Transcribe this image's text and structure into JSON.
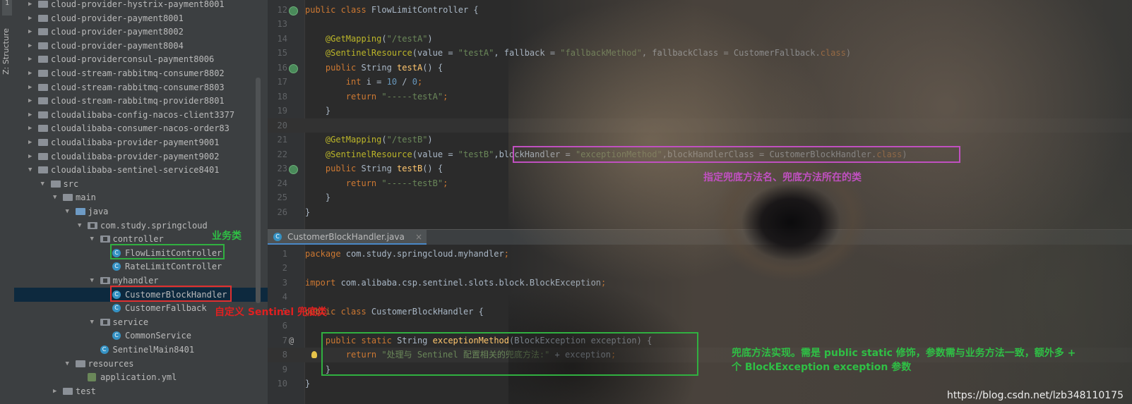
{
  "toolstrip": {
    "project_tab": "1",
    "structure_tab": "Z: Structure"
  },
  "tree": [
    {
      "label": "cloud-provider-hystrix-payment8001",
      "level": 1,
      "type": "module",
      "arrow": "▶"
    },
    {
      "label": "cloud-provider-payment8001",
      "level": 1,
      "type": "module",
      "arrow": "▶"
    },
    {
      "label": "cloud-provider-payment8002",
      "level": 1,
      "type": "module",
      "arrow": "▶"
    },
    {
      "label": "cloud-provider-payment8004",
      "level": 1,
      "type": "module",
      "arrow": "▶"
    },
    {
      "label": "cloud-providerconsul-payment8006",
      "level": 1,
      "type": "module",
      "arrow": "▶"
    },
    {
      "label": "cloud-stream-rabbitmq-consumer8802",
      "level": 1,
      "type": "module",
      "arrow": "▶"
    },
    {
      "label": "cloud-stream-rabbitmq-consumer8803",
      "level": 1,
      "type": "module",
      "arrow": "▶"
    },
    {
      "label": "cloud-stream-rabbitmq-provider8801",
      "level": 1,
      "type": "module",
      "arrow": "▶"
    },
    {
      "label": "cloudalibaba-config-nacos-client3377",
      "level": 1,
      "type": "module",
      "arrow": "▶"
    },
    {
      "label": "cloudalibaba-consumer-nacos-order83",
      "level": 1,
      "type": "module",
      "arrow": "▶"
    },
    {
      "label": "cloudalibaba-provider-payment9001",
      "level": 1,
      "type": "module",
      "arrow": "▶"
    },
    {
      "label": "cloudalibaba-provider-payment9002",
      "level": 1,
      "type": "module",
      "arrow": "▶"
    },
    {
      "label": "cloudalibaba-sentinel-service8401",
      "level": 1,
      "type": "module",
      "arrow": "▼"
    },
    {
      "label": "src",
      "level": 2,
      "type": "folder",
      "arrow": "▼"
    },
    {
      "label": "main",
      "level": 3,
      "type": "folder",
      "arrow": "▼"
    },
    {
      "label": "java",
      "level": 4,
      "type": "folder-blue",
      "arrow": "▼"
    },
    {
      "label": "com.study.springcloud",
      "level": 5,
      "type": "package",
      "arrow": "▼"
    },
    {
      "label": "controller",
      "level": 6,
      "type": "package",
      "arrow": "▼"
    },
    {
      "label": "FlowLimitController",
      "level": 7,
      "type": "class",
      "arrow": ""
    },
    {
      "label": "RateLimitController",
      "level": 7,
      "type": "class",
      "arrow": ""
    },
    {
      "label": "myhandler",
      "level": 6,
      "type": "package",
      "arrow": "▼"
    },
    {
      "label": "CustomerBlockHandler",
      "level": 7,
      "type": "class",
      "arrow": "",
      "selected": true
    },
    {
      "label": "CustomerFallback",
      "level": 7,
      "type": "class",
      "arrow": ""
    },
    {
      "label": "service",
      "level": 6,
      "type": "package",
      "arrow": "▼"
    },
    {
      "label": "CommonService",
      "level": 7,
      "type": "class",
      "arrow": ""
    },
    {
      "label": "SentinelMain8401",
      "level": 6,
      "type": "spring",
      "arrow": ""
    },
    {
      "label": "resources",
      "level": 4,
      "type": "folder",
      "arrow": "▼"
    },
    {
      "label": "application.yml",
      "level": 5,
      "type": "yml",
      "arrow": ""
    },
    {
      "label": "test",
      "level": 3,
      "type": "folder",
      "arrow": "▶"
    }
  ],
  "editor_top": {
    "lines": [
      {
        "n": "12",
        "icon": true,
        "tokens": [
          [
            "kw",
            "public class "
          ],
          [
            "lv",
            "FlowLimitController {"
          ]
        ]
      },
      {
        "n": "13",
        "tokens": []
      },
      {
        "n": "14",
        "tokens": [
          [
            "lv",
            "    "
          ],
          [
            "an",
            "@GetMapping"
          ],
          [
            "lv",
            "("
          ],
          [
            "st",
            "\"/testA\""
          ],
          [
            "lv",
            ")"
          ]
        ]
      },
      {
        "n": "15",
        "tokens": [
          [
            "lv",
            "    "
          ],
          [
            "an",
            "@SentinelResource"
          ],
          [
            "lv",
            "("
          ],
          [
            "lv",
            "value = "
          ],
          [
            "st",
            "\"testA\""
          ],
          [
            "lv",
            ", fallback = "
          ],
          [
            "st",
            "\"fallbackMethod\""
          ],
          [
            "lv",
            ", fallbackClass = CustomerFallback."
          ],
          [
            "kw",
            "class"
          ],
          [
            "lv",
            ")"
          ]
        ]
      },
      {
        "n": "16",
        "icon": true,
        "tokens": [
          [
            "lv",
            "    "
          ],
          [
            "kw",
            "public "
          ],
          [
            "lv",
            "String "
          ],
          [
            "fn",
            "testA"
          ],
          [
            "lv",
            "() {"
          ]
        ]
      },
      {
        "n": "17",
        "tokens": [
          [
            "lv",
            "        "
          ],
          [
            "kw",
            "int "
          ],
          [
            "lv",
            "i = "
          ],
          [
            "nm",
            "10"
          ],
          [
            "lv",
            " / "
          ],
          [
            "nm",
            "0"
          ],
          [
            "kw",
            ";"
          ]
        ]
      },
      {
        "n": "18",
        "tokens": [
          [
            "lv",
            "        "
          ],
          [
            "kw",
            "return "
          ],
          [
            "st",
            "\"-----testA\""
          ],
          [
            "kw",
            ";"
          ]
        ]
      },
      {
        "n": "19",
        "tokens": [
          [
            "lv",
            "    }"
          ]
        ]
      },
      {
        "n": "20",
        "cur": true,
        "tokens": []
      },
      {
        "n": "21",
        "tokens": [
          [
            "lv",
            "    "
          ],
          [
            "an",
            "@GetMapping"
          ],
          [
            "lv",
            "("
          ],
          [
            "st",
            "\"/testB\""
          ],
          [
            "lv",
            ")"
          ]
        ]
      },
      {
        "n": "22",
        "tokens": [
          [
            "lv",
            "    "
          ],
          [
            "an",
            "@SentinelResource"
          ],
          [
            "lv",
            "("
          ],
          [
            "lv",
            "value = "
          ],
          [
            "st",
            "\"testB\""
          ],
          [
            "lv",
            ",blockHandler = "
          ],
          [
            "st",
            "\"exceptionMethod\""
          ],
          [
            "lv",
            ",blockHandlerClass = CustomerBlockHandler."
          ],
          [
            "kw",
            "class"
          ],
          [
            "lv",
            ")"
          ]
        ]
      },
      {
        "n": "23",
        "icon": true,
        "tokens": [
          [
            "lv",
            "    "
          ],
          [
            "kw",
            "public "
          ],
          [
            "lv",
            "String "
          ],
          [
            "fn",
            "testB"
          ],
          [
            "lv",
            "() {"
          ]
        ]
      },
      {
        "n": "24",
        "tokens": [
          [
            "lv",
            "        "
          ],
          [
            "kw",
            "return "
          ],
          [
            "st",
            "\"-----testB\""
          ],
          [
            "kw",
            ";"
          ]
        ]
      },
      {
        "n": "25",
        "tokens": [
          [
            "lv",
            "    }"
          ]
        ]
      },
      {
        "n": "26",
        "tokens": [
          [
            "lv",
            "}"
          ]
        ]
      }
    ]
  },
  "tab": {
    "label": "CustomerBlockHandler.java",
    "close": "×"
  },
  "editor_bottom": {
    "lines": [
      {
        "n": "1",
        "tokens": [
          [
            "kw",
            "package "
          ],
          [
            "lv",
            "com.study.springcloud.myhandler"
          ],
          [
            "kw",
            ";"
          ]
        ]
      },
      {
        "n": "2",
        "tokens": []
      },
      {
        "n": "3",
        "tokens": [
          [
            "kw",
            "import "
          ],
          [
            "lv",
            "com.alibaba.csp.sentinel.slots.block.BlockException"
          ],
          [
            "kw",
            ";"
          ]
        ]
      },
      {
        "n": "4",
        "tokens": []
      },
      {
        "n": "5",
        "tokens": [
          [
            "kw",
            "public class "
          ],
          [
            "lv",
            "CustomerBlockHandler {"
          ]
        ]
      },
      {
        "n": "6",
        "tokens": []
      },
      {
        "n": "7",
        "gmark": "@",
        "tokens": [
          [
            "lv",
            "    "
          ],
          [
            "kw",
            "public static "
          ],
          [
            "lv",
            "String "
          ],
          [
            "fn",
            "exceptionMethod"
          ],
          [
            "lv",
            "(BlockException exception) {"
          ]
        ]
      },
      {
        "n": "8",
        "cur": true,
        "bulb": true,
        "tokens": [
          [
            "lv",
            "        "
          ],
          [
            "kw",
            "return "
          ],
          [
            "st",
            "\"处理与 Sentinel 配置相关的兜底方法:\""
          ],
          [
            "lv",
            " + exception"
          ],
          [
            "kw",
            ";"
          ]
        ]
      },
      {
        "n": "9",
        "tokens": [
          [
            "lv",
            "    }"
          ]
        ]
      },
      {
        "n": "10",
        "tokens": [
          [
            "lv",
            "}"
          ]
        ]
      }
    ]
  },
  "annotations": {
    "magenta_note": "指定兜底方法名、兜底方法所在的类",
    "business_class": "业务类",
    "custom_handler": "自定义 Sentinel 兜底类",
    "impl_note_1": "兜底方法实现。需是 public static 修饰，参数需与业务方法一致，额外多 +",
    "impl_note_2": "个 BlockException exception 参数"
  },
  "watermark": "https://blog.csdn.net/lzb348110175"
}
